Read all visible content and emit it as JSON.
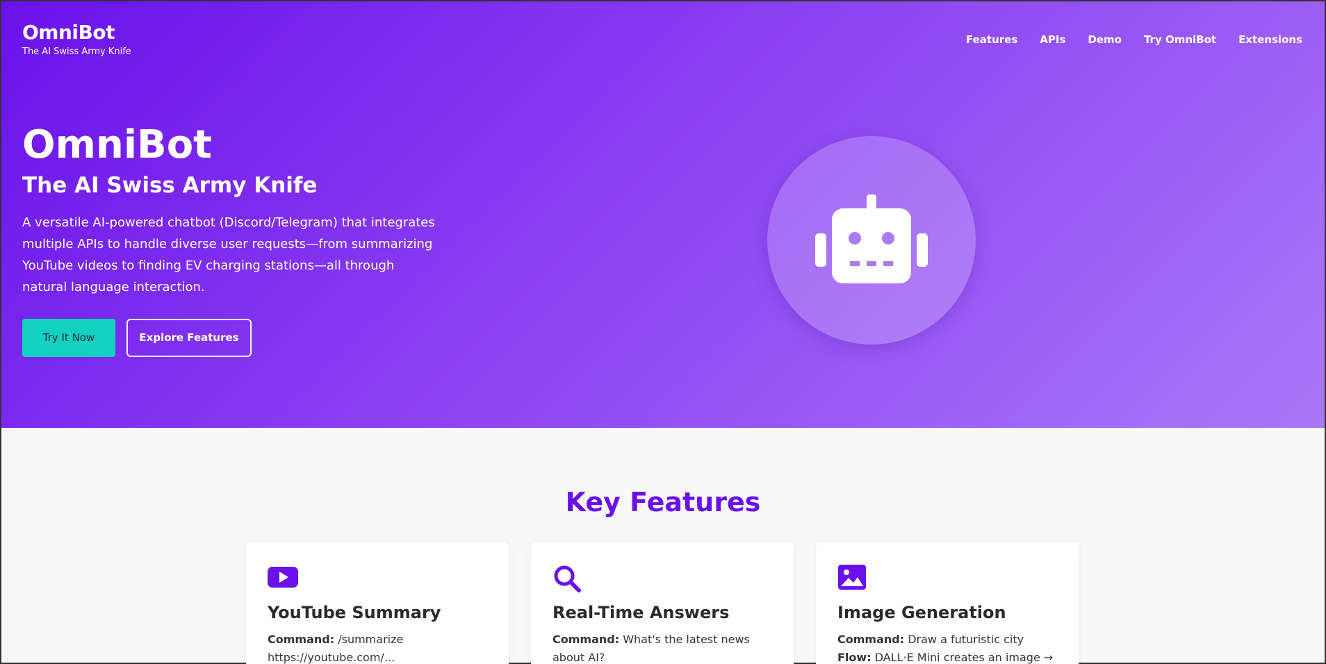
{
  "brand": {
    "name": "OmniBot",
    "tagline": "The AI Swiss Army Knife"
  },
  "nav": {
    "items": [
      "Features",
      "APIs",
      "Demo",
      "Try OmniBot",
      "Extensions"
    ]
  },
  "hero": {
    "title": "OmniBot",
    "subtitle": "The AI Swiss Army Knife",
    "description": "A versatile AI-powered chatbot (Discord/Telegram) that integrates multiple APIs to handle diverse user requests—from summarizing YouTube videos to finding EV charging stations—all through natural language interaction.",
    "primary_button": "Try It Now",
    "secondary_button": "Explore Features",
    "icon": "robot-icon"
  },
  "features": {
    "title": "Key Features",
    "cards": [
      {
        "icon": "youtube-icon",
        "title": "YouTube Summary",
        "label1": "Command:",
        "text1": "/summarize https://youtube.com/..."
      },
      {
        "icon": "search-icon",
        "title": "Real-Time Answers",
        "label1": "Command:",
        "text1": "What's the latest news about AI?"
      },
      {
        "icon": "image-icon",
        "title": "Image Generation",
        "label1": "Command:",
        "text1": "Draw a futuristic city",
        "label2": "Flow:",
        "text2": "DALL·E Mini creates an image → Bot"
      }
    ]
  },
  "colors": {
    "accent": "#6a11ea",
    "button": "#12d1c0"
  }
}
